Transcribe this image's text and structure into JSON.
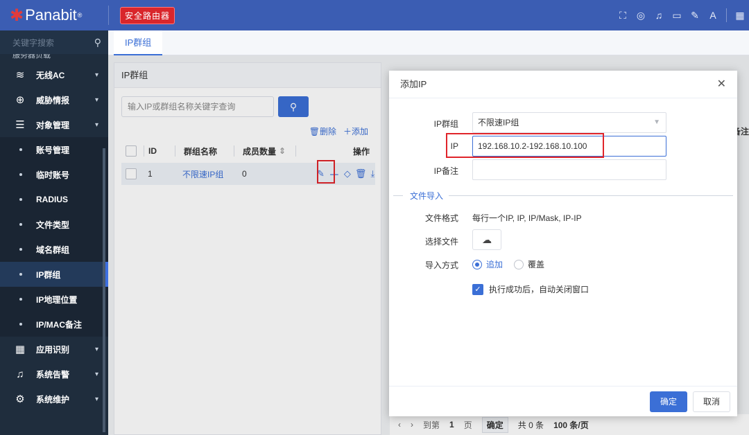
{
  "brand": {
    "name": "Panabit",
    "reg": "®",
    "badge": "安全路由器"
  },
  "topbar_icons": [
    "expand-icon",
    "palette-icon",
    "bell-icon",
    "book-icon",
    "pen-icon",
    "translate-icon",
    "grid-icon"
  ],
  "sidebar": {
    "search_placeholder": "关键字搜索",
    "cut_item": "服务器负载",
    "items": [
      {
        "label": "无线AC",
        "icon": "wifi-icon"
      },
      {
        "label": "威胁情报",
        "icon": "target-icon"
      },
      {
        "label": "对象管理",
        "icon": "database-icon"
      }
    ],
    "sub_items": [
      "账号管理",
      "临时账号",
      "RADIUS",
      "文件类型",
      "域名群组",
      "IP群组",
      "IP地理位置",
      "IP/MAC备注"
    ],
    "active_sub": "IP群组",
    "bottom_items": [
      {
        "label": "应用识别",
        "icon": "apps-icon"
      },
      {
        "label": "系统告警",
        "icon": "bell-icon"
      },
      {
        "label": "系统维护",
        "icon": "gear-icon"
      }
    ]
  },
  "tabs": [
    {
      "label": "IP群组"
    }
  ],
  "panel": {
    "title": "IP群组",
    "search_placeholder": "输入IP或群组名称关键字查询",
    "delete_label": "删除",
    "add_label": "添加",
    "columns": {
      "id": "ID",
      "name": "群组名称",
      "count": "成员数量",
      "ops": "操作"
    },
    "rows": [
      {
        "id": "1",
        "name": "不限速IP组",
        "count": "0"
      }
    ]
  },
  "right_hint": "备注",
  "pager": {
    "goto": "到第",
    "page": "1",
    "page_unit": "页",
    "confirm": "确定",
    "total": "共 0 条",
    "per_page": "100 条/页"
  },
  "dialog": {
    "title": "添加IP",
    "group_label": "IP群组",
    "group_value": "不限速IP组",
    "ip_label": "IP",
    "ip_value": "192.168.10.2-192.168.10.100",
    "note_label": "IP备注",
    "note_value": "",
    "section": "文件导入",
    "format_label": "文件格式",
    "format_value": "每行一个IP, IP, IP/Mask, IP-IP",
    "file_label": "选择文件",
    "import_label": "导入方式",
    "import_options": [
      "追加",
      "覆盖"
    ],
    "import_selected": "追加",
    "auto_close": "执行成功后，自动关闭窗口",
    "ok": "确定",
    "cancel": "取消"
  },
  "colors": {
    "primary": "#3b6fd6",
    "topbar": "#3b5db3",
    "sidebar": "#1f2d3d",
    "highlight": "#e0242a"
  }
}
